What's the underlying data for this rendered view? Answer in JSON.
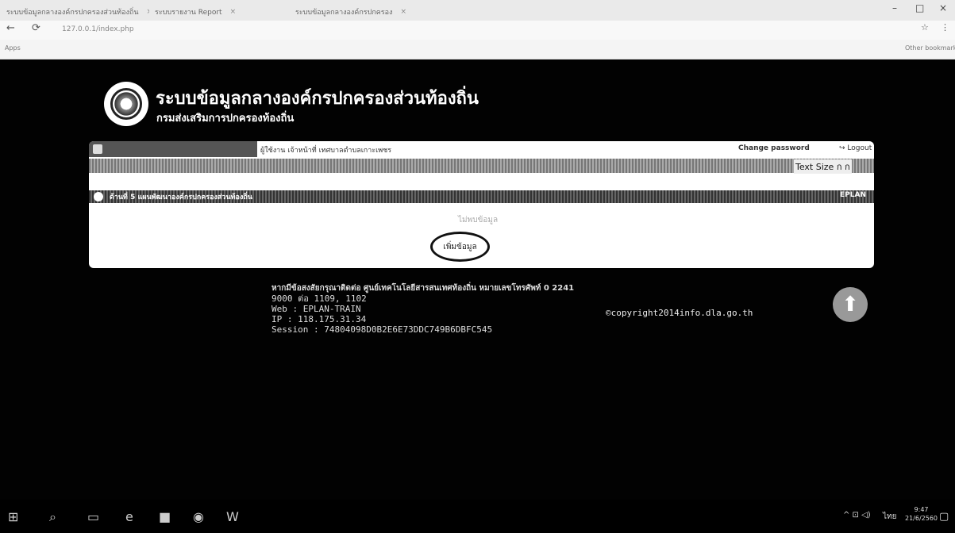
{
  "browser": {
    "tabs": [
      {
        "label": "ระบบข้อมูลกลางองค์กรปกครองส่วนท้องถิ่น"
      },
      {
        "label": "ระบบรายงาน Report"
      },
      {
        "label": "ระบบข้อมูลกลางองค์กรปกครอง"
      }
    ],
    "url": "127.0.0.1/index.php",
    "bookmarks": [
      "Apps",
      "Other bookmarks"
    ]
  },
  "site": {
    "title": "ระบบข้อมูลกลางองค์กรปกครองส่วนท้องถิ่น",
    "subtitle": "กรมส่งเสริมการปกครองท้องถิ่น"
  },
  "topbar": {
    "user_line": "ผู้ใช้งาน เจ้าหน้าที่ เทศบาลตำบลเกาะเพชร",
    "change_password": "Change password",
    "logout": "Logout",
    "text_size_label": "Text Size",
    "text_size_options": "ก ก"
  },
  "section": {
    "title": "ด้านที่ 5 แผนพัฒนาองค์กรปกครองส่วนท้องถิ่น",
    "code": "EPLAN"
  },
  "content": {
    "no_data": "ไม่พบข้อมูล",
    "add_button": "เพิ่มข้อมูล"
  },
  "footer": {
    "contact_line": "หากมีข้อสงสัยกรุณาติดต่อ ศูนย์เทคโนโลยีสารสนเทศท้องถิ่น หมายเลขโทรศัพท์ 0 2241",
    "phone_line": "9000 ต่อ 1109, 1102",
    "web": "Web : EPLAN-TRAIN",
    "ip": "IP : 118.175.31.34",
    "session": "Session : 74804098D0B2E6E73DDC749B6DBFC545",
    "copyright": "©copyright2014info.dla.go.th"
  },
  "taskbar": {
    "lang": "ไทย",
    "time": "9:47",
    "date": "21/6/2560"
  }
}
